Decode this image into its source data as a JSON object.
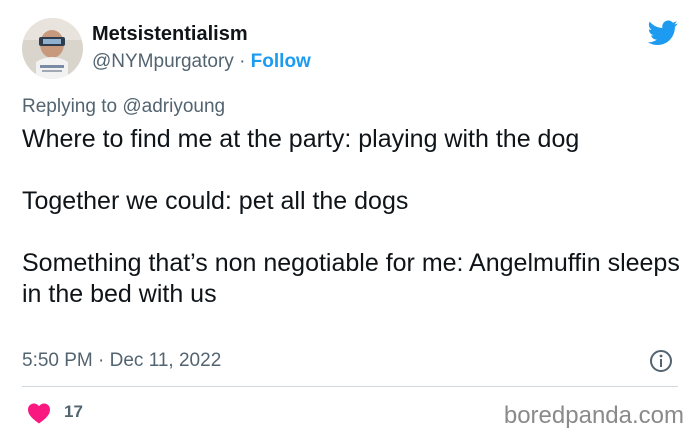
{
  "user": {
    "display_name": "Metsistentialism",
    "handle": "@NYMpurgatory",
    "separator": "·",
    "follow_label": "Follow"
  },
  "reply": {
    "prefix": "Replying to",
    "target": "@adriyoung"
  },
  "tweet": {
    "paragraphs": [
      "Where to find me at the party: playing with the dog",
      "Together we could: pet all the dogs",
      "Something that’s non negotiable for me: Angelmuffin sleeps in the bed with us"
    ],
    "timestamp": "5:50 PM · Dec 11, 2022"
  },
  "engagement": {
    "likes": "17"
  },
  "watermark": "boredpanda.com",
  "icons": {
    "brand": "twitter-bird-icon",
    "info": "info-icon",
    "like": "heart-icon"
  },
  "colors": {
    "twitter_blue": "#1d9bf0",
    "heart_pink": "#f91880",
    "muted_text": "#536471"
  }
}
